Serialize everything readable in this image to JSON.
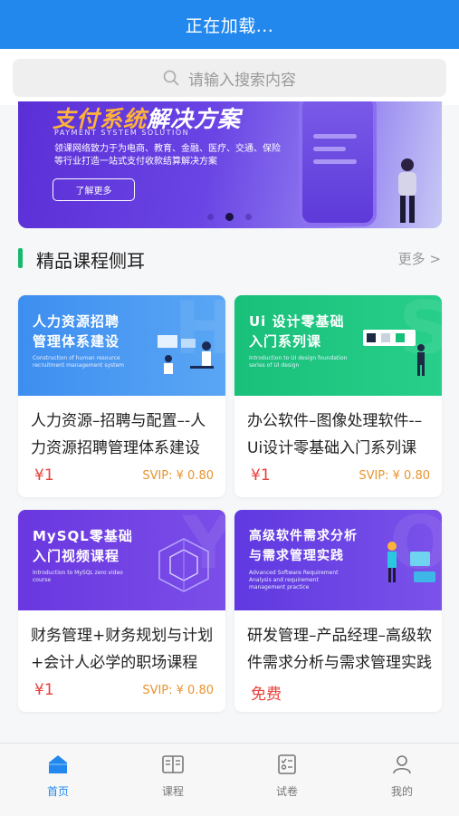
{
  "header": {
    "title": "正在加载..."
  },
  "search": {
    "placeholder": "请输入搜索内容",
    "icon": "search-icon"
  },
  "banner": {
    "title_main": "支付系统",
    "title_accent": "解决方案",
    "subtitle_en": "PAYMENT SYSTEM SOLUTION",
    "description": "领课网络致力于为电商、教育、金融、医疗、交通、保险等行业打造一站式支付收款结算解决方案",
    "button_label": "了解更多",
    "page_count": 3,
    "active_page": 2
  },
  "section": {
    "title": "精品课程侧耳",
    "more_label": "更多 >",
    "accent_color": "#18b86e"
  },
  "courses": [
    {
      "thumb_title_1": "人力资源招聘",
      "thumb_title_2": "管理体系建设",
      "thumb_sub": "Construction of human resource recruitment management system",
      "title": "人力资源–招聘与配置–-人力资源招聘管理体系建设",
      "price": "¥1",
      "svip": "SVIP: ¥ 0.80"
    },
    {
      "thumb_title_1": "Ui 设计零基础",
      "thumb_title_2": "入门系列课",
      "thumb_sub": "Introduction to UI design foundation series of UI design",
      "title": "办公软件–图像处理软件-–Ui设计零基础入门系列课",
      "price": "¥1",
      "svip": "SVIP: ¥ 0.80"
    },
    {
      "thumb_title_1": "MySQL零基础",
      "thumb_title_2": "入门视频课程",
      "thumb_sub": "Introduction to MySQL zero video course",
      "title": "财务管理+财务规划与计划+会计人必学的职场课程",
      "price": "¥1",
      "svip": "SVIP: ¥ 0.80"
    },
    {
      "thumb_title_1": "高级软件需求分析",
      "thumb_title_2": "与需求管理实践",
      "thumb_sub": "Advanced Software Requirement Analysis and requirement management practice",
      "title": "研发管理–产品经理–高级软件需求分析与需求管理实践",
      "price": "免费",
      "svip": ""
    }
  ],
  "tabbar": {
    "items": [
      {
        "label": "首页",
        "icon": "home-icon",
        "active": true
      },
      {
        "label": "课程",
        "icon": "book-icon",
        "active": false
      },
      {
        "label": "试卷",
        "icon": "exam-paper-icon",
        "active": false
      },
      {
        "label": "我的",
        "icon": "user-icon",
        "active": false
      }
    ],
    "active_color": "#2288ee"
  }
}
